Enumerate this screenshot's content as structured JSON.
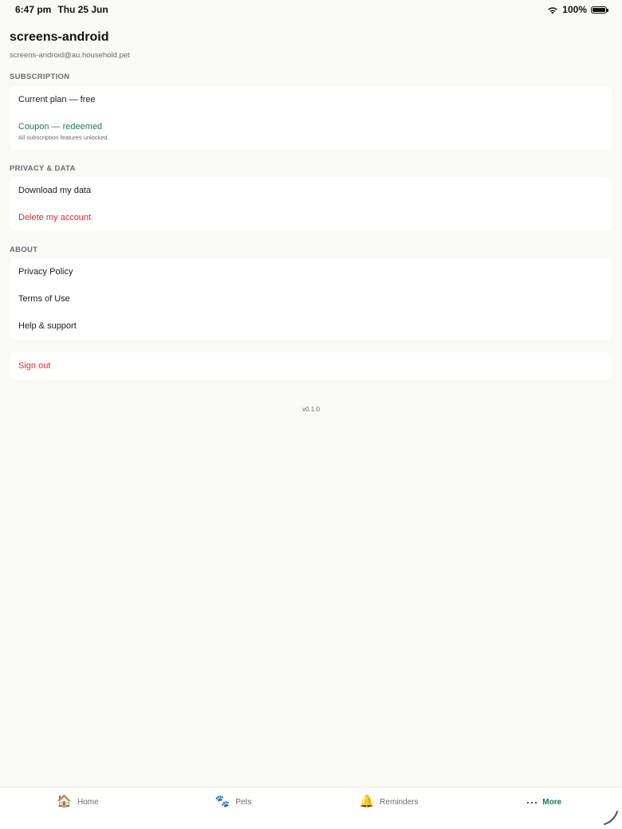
{
  "status_bar": {
    "time": "6:47 pm",
    "date": "Thu 25 Jun",
    "battery": "100%",
    "wifi_icon": "wifi-icon",
    "battery_icon": "battery-full-icon"
  },
  "profile": {
    "name": "screens-android",
    "email": "screens-android@au.household.pet"
  },
  "sections": {
    "subscription": {
      "title": "SUBSCRIPTION",
      "current_plan": "Current plan — free",
      "coupon": "Coupon — redeemed",
      "coupon_note": "All subscription features unlocked."
    },
    "privacy": {
      "title": "PRIVACY & DATA",
      "download": "Download my data",
      "delete": "Delete my account"
    },
    "about": {
      "title": "ABOUT",
      "privacy_policy": "Privacy Policy",
      "terms": "Terms of Use",
      "help": "Help & support"
    },
    "account": {
      "sign_out": "Sign out"
    }
  },
  "version": "v0.1.0",
  "tab_bar": {
    "items": [
      {
        "label": "Home",
        "icon": "🏠"
      },
      {
        "label": "Pets",
        "icon": "🐾"
      },
      {
        "label": "Reminders",
        "icon": "🔔"
      },
      {
        "label": "More",
        "icon": "more-dots-icon"
      }
    ],
    "active": "More"
  },
  "colors": {
    "accent": "#1f7a4d",
    "danger": "#d32f2f",
    "background": "#f9f9f6"
  }
}
